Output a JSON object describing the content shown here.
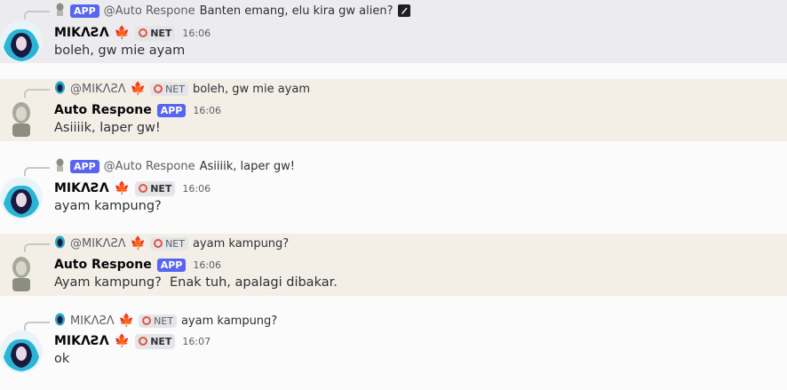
{
  "messages": [
    {
      "reply": {
        "app_badge": "APP",
        "name": "@Auto Respone",
        "text": "Banten emang, elu kira gw alien?"
      },
      "author": "MIKΛƧΛ",
      "flag": "🍁",
      "tag": "NET",
      "time": "16:06",
      "body": "boleh, gw mie ayam"
    },
    {
      "reply": {
        "name": "@MIKΛƧΛ",
        "flag": "🍁",
        "tag": "NET",
        "text": "boleh, gw mie ayam"
      },
      "author": "Auto Respone",
      "app_badge": "APP",
      "time": "16:06",
      "body": "Asiiiik, laper gw!"
    },
    {
      "reply": {
        "app_badge": "APP",
        "name": "@Auto Respone",
        "text": "Asiiiik, laper gw!"
      },
      "author": "MIKΛƧΛ",
      "flag": "🍁",
      "tag": "NET",
      "time": "16:06",
      "body": "ayam kampung?"
    },
    {
      "reply": {
        "name": "@MIKΛƧΛ",
        "flag": "🍁",
        "tag": "NET",
        "text": "ayam kampung?"
      },
      "author": "Auto Respone",
      "app_badge": "APP",
      "time": "16:06",
      "body": "Ayam kampung?  Enak tuh, apalagi dibakar."
    },
    {
      "reply": {
        "name": "MIKΛƧΛ",
        "flag": "🍁",
        "tag": "NET",
        "text": "ayam kampung?"
      },
      "author": "MIKΛƧΛ",
      "flag": "🍁",
      "tag": "NET",
      "time": "16:07",
      "body": "ok"
    }
  ],
  "colors": {
    "app_badge": "#5865f2",
    "highlight_bg": "#f3efe7",
    "hover_bg": "#ececee",
    "page_bg": "#fbfbfb"
  }
}
